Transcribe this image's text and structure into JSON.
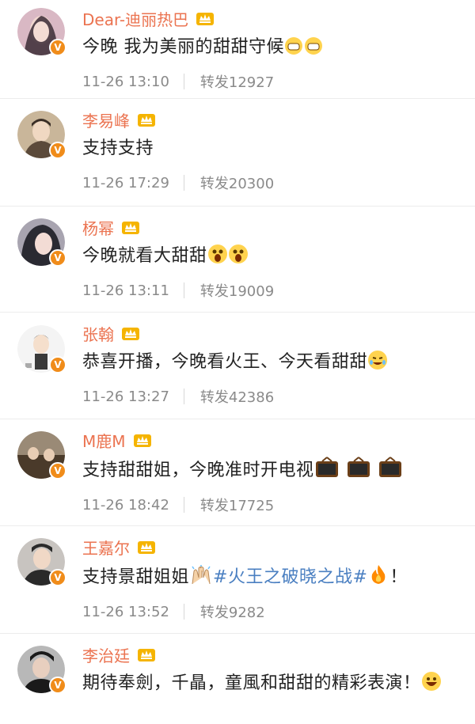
{
  "comments": [
    {
      "name": "Dear-迪丽热巴",
      "text": "今晚 我为美丽的甜甜守候",
      "time": "11-26 13:10",
      "repost": "转发12927",
      "avatar_colors": [
        "#d9b8c4",
        "#3a2a35"
      ]
    },
    {
      "name": "李易峰",
      "text": "支持支持",
      "time": "11-26 17:29",
      "repost": "转发20300",
      "avatar_colors": [
        "#c9b69a",
        "#5b4a3a"
      ]
    },
    {
      "name": "杨幂",
      "text": "今晚就看大甜甜",
      "time": "11-26 13:11",
      "repost": "转发19009",
      "avatar_colors": [
        "#a8a4b0",
        "#2a2a32"
      ]
    },
    {
      "name": "张翰",
      "text": "恭喜开播，今晚看火王、今天看甜甜",
      "time": "11-26 13:27",
      "repost": "转发42386",
      "avatar_colors": [
        "#f4f4f4",
        "#3a3a3a"
      ]
    },
    {
      "name": "M鹿M",
      "text": "支持甜甜姐，今晚准时开电视",
      "time": "11-26 18:42",
      "repost": "转发17725",
      "avatar_colors": [
        "#9a8a76",
        "#4a3a2a"
      ]
    },
    {
      "name": "王嘉尔",
      "text_before": "支持景甜姐姐",
      "hashtag": "#火王之破晓之战#",
      "text_after": "！",
      "time": "11-26 13:52",
      "repost": "转发9282",
      "avatar_colors": [
        "#c8c4c0",
        "#2a2a2a"
      ]
    },
    {
      "name": "李治廷",
      "text": "期待奉劍，千瞐，童風和甜甜的精彩表演！",
      "avatar_colors": [
        "#b8b8b8",
        "#1a1a1a"
      ]
    }
  ],
  "badge_label": "V",
  "colors": {
    "name": "#eb7350",
    "hashtag": "#4a7fc1",
    "badge": "#f08c1a",
    "crown": "#f5b400"
  }
}
